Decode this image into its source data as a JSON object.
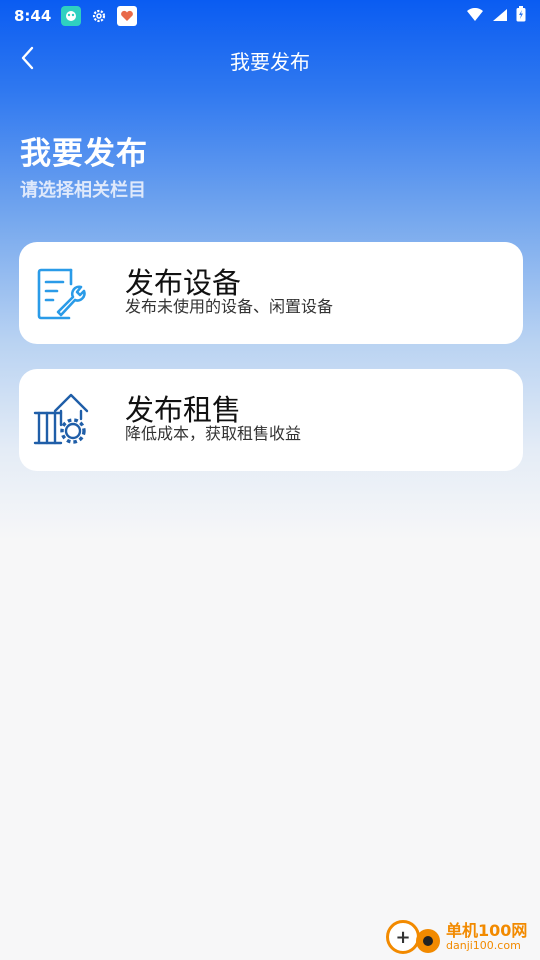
{
  "status_bar": {
    "time": "8:44",
    "icons": [
      "app-notification-icon",
      "settings-gear-icon",
      "health-app-icon",
      "wifi-icon",
      "signal-icon",
      "battery-icon"
    ]
  },
  "nav": {
    "title": "我要发布",
    "back_icon": "chevron-left-icon"
  },
  "header": {
    "title": "我要发布",
    "subtitle": "请选择相关栏目"
  },
  "options": [
    {
      "title": "发布设备",
      "description": "发布未使用的设备、闲置设备",
      "icon": "document-wrench-icon",
      "icon_color": "#2a9be8"
    },
    {
      "title": "发布租售",
      "description": "降低成本，获取租售收益",
      "icon": "house-gear-icon",
      "icon_color": "#1f5ea8"
    }
  ],
  "watermark": {
    "name": "单机100网",
    "domain": "danji100.com"
  },
  "colors": {
    "header_blue": "#0a5cf2",
    "background": "#f7f7f8",
    "card": "#ffffff",
    "watermark": "#f28a00"
  }
}
